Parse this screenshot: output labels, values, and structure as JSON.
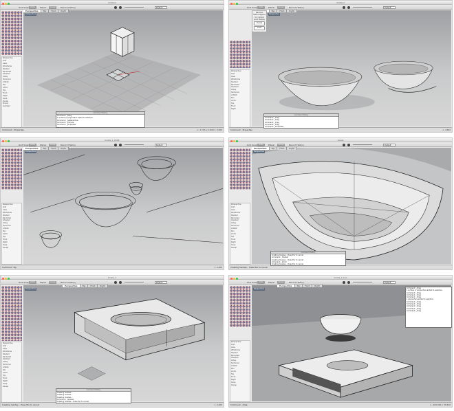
{
  "app": {
    "toolbar_items": [
      "Grid Snap",
      "Ortho",
      "Planar",
      "Osnap",
      "Record History"
    ],
    "dropdown": "Default"
  },
  "panels": [
    {
      "window_title": "Untitled",
      "tabs": [
        "Perspective",
        "Top",
        "Front",
        "Right"
      ],
      "viewport_label": "Perspective",
      "command_title": "Command History",
      "command_lines": [
        "Command: _Drag",
        "1 surface or polysurface added to selection.",
        "Command: _SetRedoView",
        "Command: _Extrude",
        "Command: _Properties"
      ],
      "status_left": "Command: _Properties",
      "status_right": "x: -2.705  y: 4.800  z: 0.000"
    },
    {
      "window_title": "Untitled",
      "tabs": [
        "Perspective",
        "Top",
        "Front",
        "Right"
      ],
      "viewport_label": "Perspective",
      "context_lines": [
        "Revolve",
        "Select objects",
        "for current",
        "pivot display"
      ],
      "context_buttons": [
        "Curves",
        "Lines"
      ],
      "command_title": "Command History",
      "command_lines": [
        "Command: _Drag",
        "Command: _Drag",
        "Command: _Drag",
        "Command: _Drag",
        "Command: _Properties"
      ],
      "status_left": "Command: _Properties",
      "status_right": "x: 4.800"
    },
    {
      "window_title": "bowls_1_0006",
      "tabs": [
        "Perspective",
        "Top",
        "Front",
        "Right"
      ],
      "viewport_label": "Perspective",
      "command_title": "",
      "command_lines": [],
      "status_left": "Command: Top",
      "status_right": "x: 0.000"
    },
    {
      "window_title": "bowls",
      "tabs": [
        "Perspective",
        "Top",
        "Front",
        "Right"
      ],
      "viewport_label": "Perspective",
      "command_title": "Command History",
      "command_lines": [
        "Creating meshes... Press Esc to cancel",
        "Command: _Shaded",
        "Creating meshes... Press Esc to cancel",
        "Command: _Zoom",
        "Creating meshes... Press Esc to cancel"
      ],
      "status_left": "Creating meshes... Press Esc to cancel",
      "status_right": ""
    },
    {
      "window_title": "bowls_1",
      "tabs": [
        "Perspective",
        "Top",
        "Front",
        "Right"
      ],
      "viewport_label": "Perspective",
      "command_title": "Command History",
      "command_lines": [
        "Creating meshes...",
        "Creating meshes...",
        "Creating meshes...",
        "Command: _Shaded",
        "Creating meshes... Press Esc to cancel"
      ],
      "status_left": "Creating meshes... Press Esc to cancel",
      "status_right": "x: 0.000"
    },
    {
      "window_title": "bowls_2_box",
      "tabs": [
        "Perspective",
        "Top",
        "Front",
        "Right"
      ],
      "viewport_label": "Perspective",
      "command_title": "",
      "command_lines": [
        "Command: _Drag",
        "1 surface or polysurface added to selection.",
        "Command: _Drag",
        "Command: _Drag",
        "Command: _Drag",
        "1 polysurface added to selection.",
        "Command: _Drag",
        "Command: _Drag",
        "Command: _Drag",
        "Command: _Drag",
        "Command: _Drag"
      ],
      "status_left": "Command: _Drag",
      "status_right": "x: -909.028  y: 56.816"
    }
  ],
  "sidebar_items": [
    "Perspective",
    "Grid",
    "Axes",
    "Wireframe",
    "Shaded",
    "Rendered",
    "Ghosted",
    "X-Ray",
    "Technical",
    "Artistic",
    "Pen",
    "Arctic",
    "Top",
    "Front",
    "Right",
    "Snap",
    "Osnap",
    "Planar",
    "Gumball",
    "Filter",
    "History"
  ],
  "colors": {
    "viewport": "#b7b8ba",
    "accent": "#5a6a7c",
    "bg": "#e9e9e9"
  }
}
